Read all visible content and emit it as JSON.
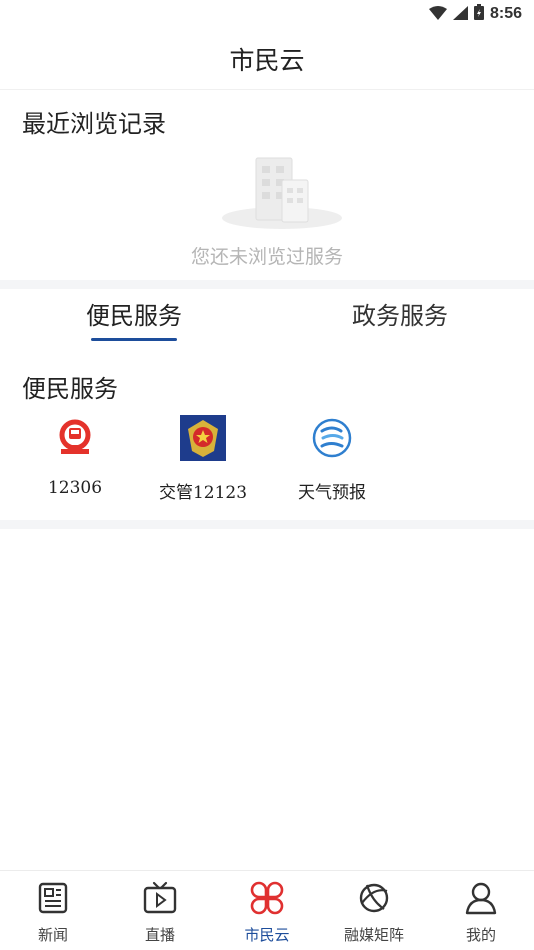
{
  "status_bar": {
    "time": "8:56"
  },
  "header": {
    "title": "市民云"
  },
  "recent": {
    "heading": "最近浏览记录",
    "empty_text": "您还未浏览过服务"
  },
  "tabs": [
    {
      "label": "便民服务",
      "active": true
    },
    {
      "label": "政务服务",
      "active": false
    }
  ],
  "services": {
    "heading": "便民服务",
    "items": [
      {
        "label": "12306",
        "icon": "railway-icon"
      },
      {
        "label": "交管12123",
        "icon": "police-emblem-icon"
      },
      {
        "label": "天气预报",
        "icon": "weather-icon"
      }
    ]
  },
  "bottom_nav": [
    {
      "label": "新闻",
      "icon": "newspaper-icon",
      "active": false
    },
    {
      "label": "直播",
      "icon": "tv-play-icon",
      "active": false
    },
    {
      "label": "市民云",
      "icon": "clover-icon",
      "active": true
    },
    {
      "label": "融媒矩阵",
      "icon": "orbit-icon",
      "active": false
    },
    {
      "label": "我的",
      "icon": "user-icon",
      "active": false
    }
  ],
  "colors": {
    "accent": "#1d4d9b",
    "railway_red": "#e4322b",
    "active_nav_red": "#e03030",
    "weather_blue": "#2f7fcf"
  }
}
